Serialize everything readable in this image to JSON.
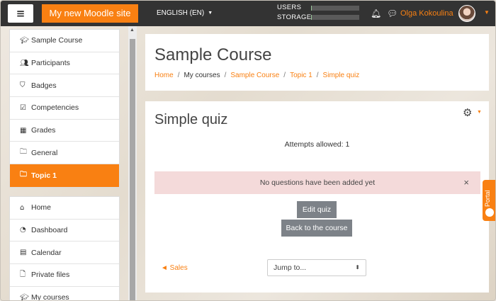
{
  "navbar": {
    "menu_label": "≡",
    "site_name": "My new Moodle site",
    "language": "ENGLISH (EN)",
    "quota": [
      {
        "label": "USERS",
        "fill_percent": 2
      },
      {
        "label": "STORAGE",
        "fill_percent": 2
      }
    ],
    "user_name": "Olga Kokoulina",
    "accent_color": "#f98012"
  },
  "sidebar": {
    "course_items": [
      {
        "label": "Sample Course",
        "icon": "graduation-cap-icon"
      },
      {
        "label": "Participants",
        "icon": "users-icon"
      },
      {
        "label": "Badges",
        "icon": "shield-icon"
      },
      {
        "label": "Competencies",
        "icon": "checkbox-icon"
      },
      {
        "label": "Grades",
        "icon": "table-icon"
      },
      {
        "label": "General",
        "icon": "folder-icon"
      },
      {
        "label": "Topic 1",
        "icon": "folder-icon",
        "active": true
      }
    ],
    "site_items": [
      {
        "label": "Home",
        "icon": "home-icon"
      },
      {
        "label": "Dashboard",
        "icon": "dashboard-icon"
      },
      {
        "label": "Calendar",
        "icon": "calendar-icon"
      },
      {
        "label": "Private files",
        "icon": "file-icon"
      },
      {
        "label": "My courses",
        "icon": "graduation-cap-icon"
      }
    ]
  },
  "header": {
    "course_title": "Sample Course",
    "breadcrumb": [
      "Home",
      "My courses",
      "Sample Course",
      "Topic 1",
      "Simple quiz"
    ]
  },
  "main": {
    "quiz_title": "Simple quiz",
    "attempts": "Attempts allowed: 1",
    "alert": "No questions have been added yet",
    "alert_close": "×",
    "edit_button": "Edit quiz",
    "back_button": "Back to the course",
    "prev_link": "◄ Sales",
    "jump_placeholder": "Jump to..."
  },
  "portal_tab": "Portal"
}
